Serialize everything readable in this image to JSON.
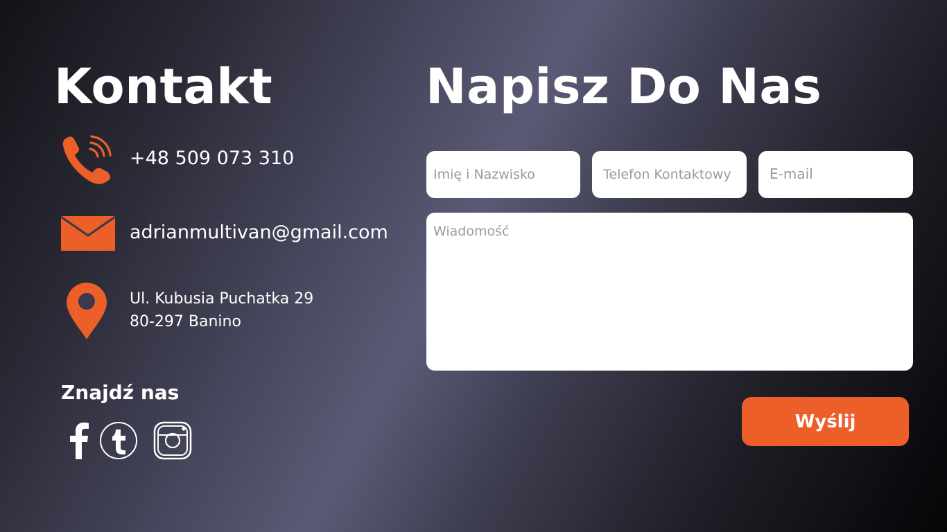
{
  "contact": {
    "title": "Kontakt",
    "phone": "+48 509 073 310",
    "email": "adrianmultivan@gmail.com",
    "address_line1": "Ul. Kubusia Puchatka 29",
    "address_line2": "80-297 Banino",
    "icons": [
      "phone-icon",
      "envelope-icon",
      "map-pin-icon"
    ]
  },
  "social": {
    "title": "Znajdź nas",
    "icons": [
      "facebook-icon",
      "tumblr-icon",
      "instagram-icon"
    ]
  },
  "form": {
    "title": "Napisz Do Nas",
    "name_placeholder": "Imię i Nazwisko",
    "phone_placeholder": "Telefon Kontaktowy",
    "email_placeholder": "E-mail",
    "message_placeholder": "Wiadomość",
    "submit_label": "Wyślij"
  },
  "colors": {
    "accent": "#ec5f29",
    "text": "#ffffff",
    "background_dark": "#050507",
    "background_light": "#5a5a76"
  }
}
